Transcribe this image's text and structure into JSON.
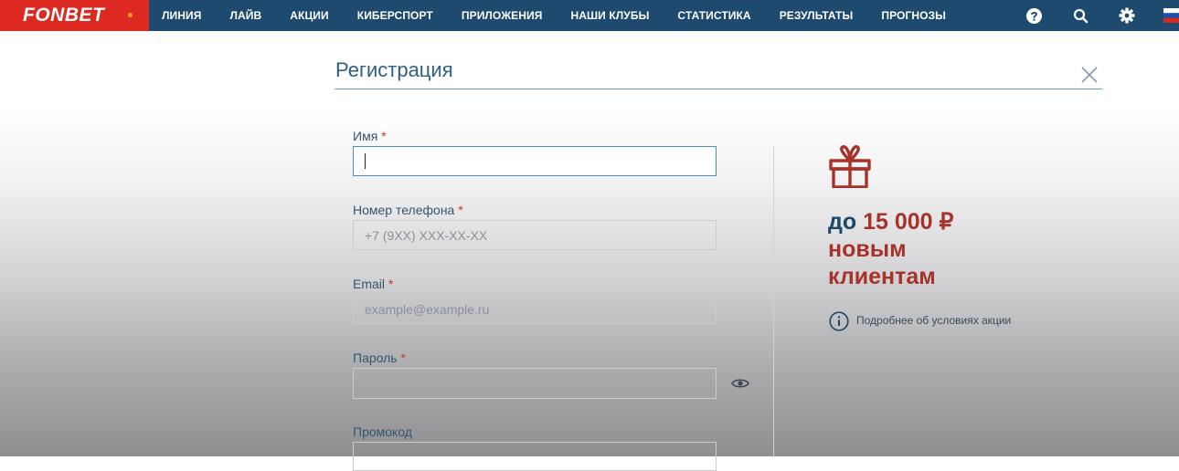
{
  "header": {
    "logo": "FONBET",
    "nav": [
      "ЛИНИЯ",
      "ЛАЙВ",
      "АКЦИИ",
      "КИБЕРСПОРТ",
      "ПРИЛОЖЕНИЯ",
      "НАШИ КЛУБЫ",
      "СТАТИСТИКА",
      "РЕЗУЛЬТАТЫ",
      "ПРОГНОЗЫ"
    ],
    "icons": [
      "help-icon",
      "search-icon",
      "gear-icon",
      "russia-flag-icon"
    ]
  },
  "form": {
    "title": "Регистрация",
    "required_mark": "*",
    "fields": [
      {
        "label": "Имя",
        "value": "",
        "placeholder": "",
        "required": true
      },
      {
        "label": "Номер телефона",
        "value": "",
        "placeholder": "+7 (9XX) XXX-XX-XX",
        "required": true
      },
      {
        "label": "Email",
        "value": "",
        "placeholder": "example@example.ru",
        "required": true
      },
      {
        "label": "Пароль",
        "value": "",
        "placeholder": "",
        "required": true
      },
      {
        "label": "Промокод",
        "value": "",
        "placeholder": "",
        "required": false
      }
    ]
  },
  "promo": {
    "prefix": "до",
    "amount": "15 000 ₽",
    "line2": "новым",
    "line3": "клиентам",
    "info_link": "Подробнее об условиях акции"
  },
  "colors": {
    "header_bg": "#1d4a6e",
    "logo_bg": "#de2922",
    "accent_red": "#a6332a",
    "title_blue": "#2f5f84"
  }
}
